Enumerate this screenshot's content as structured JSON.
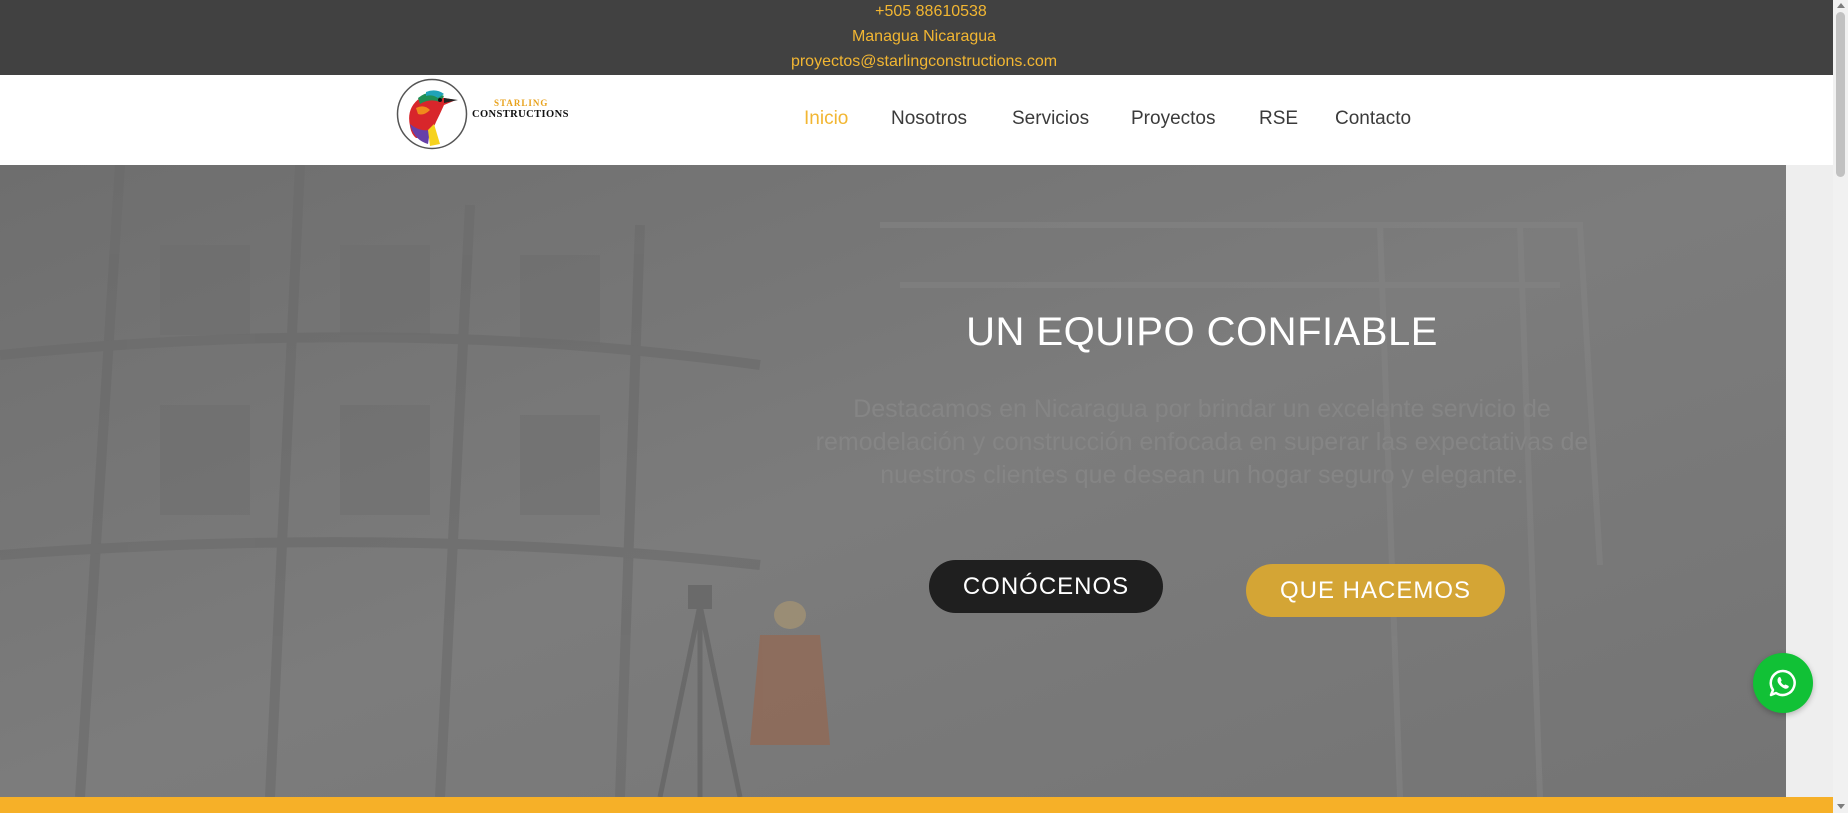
{
  "topbar": {
    "phone": "+505 88610538",
    "location": "Managua Nicaragua",
    "email": "proyectos@starlingconstructions.com",
    "text_color": "#f2b632",
    "background": "#414141"
  },
  "logo": {
    "line1": "STARLING",
    "line2": "CONSTRUCTIONS",
    "icon": "starling-bird-logo"
  },
  "nav": {
    "items": [
      {
        "label": "Inicio",
        "active": true
      },
      {
        "label": "Nosotros",
        "active": false
      },
      {
        "label": "Servicios",
        "active": false
      },
      {
        "label": "Proyectos",
        "active": false
      },
      {
        "label": "RSE",
        "active": false
      },
      {
        "label": "Contacto",
        "active": false
      }
    ],
    "active_color": "#f2b632"
  },
  "hero": {
    "title": "UN EQUIPO CONFIABLE",
    "text": "Destacamos en Nicaragua por brindar un excelente servicio de remodelación y construcción enfocada en superar las expectativas de nuestros clientes que desean un hogar seguro y elegante.",
    "primary_button": "CONÓCENOS",
    "secondary_button": "QUE HACEMOS",
    "secondary_color": "#d4a535"
  },
  "whatsapp": {
    "icon": "whatsapp-icon",
    "color": "#11c136"
  }
}
